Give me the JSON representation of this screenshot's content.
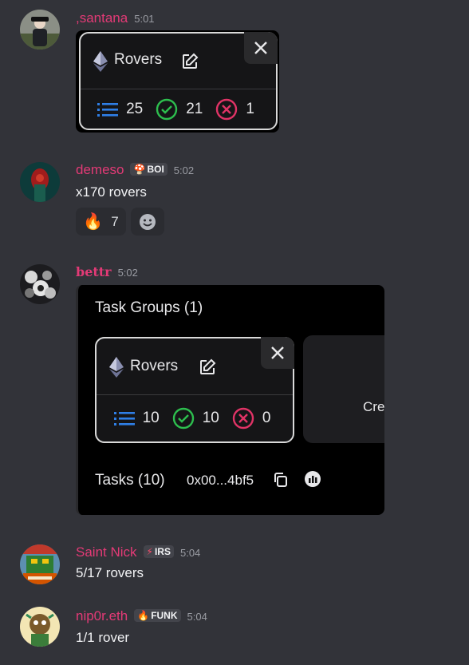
{
  "messages": [
    {
      "username": ",santana",
      "time": "5:01",
      "embed": {
        "title": "Rovers",
        "stats": {
          "total": "25",
          "success": "21",
          "failed": "1"
        }
      }
    },
    {
      "username": "demeso",
      "tag": "BOI",
      "time": "5:02",
      "text": "x170 rovers",
      "reaction": {
        "emoji": "🔥",
        "count": "7"
      }
    },
    {
      "username": "bettr",
      "time": "5:02",
      "embed": {
        "heading": "Task Groups (1)",
        "title": "Rovers",
        "stats": {
          "total": "10",
          "success": "10",
          "failed": "0"
        },
        "side_text": "Cre",
        "tasks_label": "Tasks (10)",
        "address": "0x00...4bf5"
      }
    },
    {
      "username": "Saint Nick",
      "tag": "IRS",
      "time": "5:04",
      "text": "5/17 rovers"
    },
    {
      "username": "nip0r.eth",
      "tag": "FUNK",
      "time": "5:04",
      "text": "1/1 rover"
    }
  ],
  "colors": {
    "background": "#323339",
    "username": "#e33a76",
    "list_icon": "#2f7fe6",
    "success": "#2dbe4e",
    "failed": "#e03366"
  },
  "icons": [
    "ethereum-icon",
    "edit-icon",
    "close-icon",
    "list-icon",
    "check-circle-icon",
    "x-circle-icon",
    "copy-icon",
    "add-reaction-icon"
  ]
}
